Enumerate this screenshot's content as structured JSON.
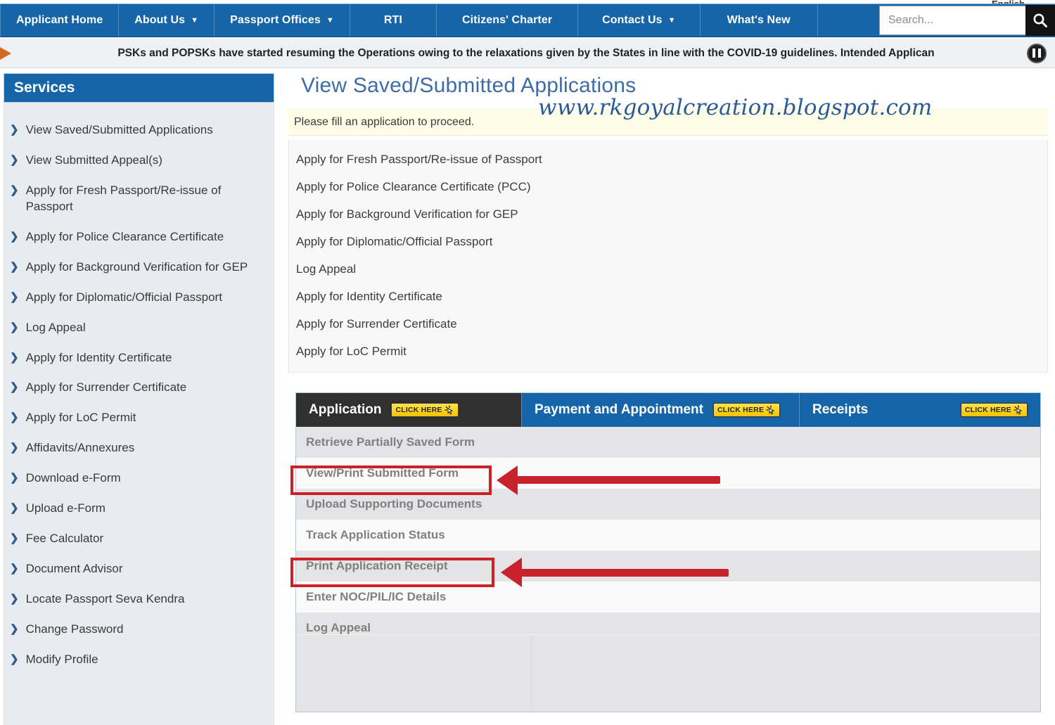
{
  "topbar": {
    "clipped_label": "English",
    "nav_items": [
      {
        "label": "Applicant Home",
        "caret": false
      },
      {
        "label": "About Us",
        "caret": true
      },
      {
        "label": "Passport Offices",
        "caret": true
      },
      {
        "label": "RTI",
        "caret": false
      },
      {
        "label": "Citizens' Charter",
        "caret": false
      },
      {
        "label": "Contact Us",
        "caret": true
      },
      {
        "label": "What's New",
        "caret": false
      }
    ],
    "search": {
      "placeholder": "Search...",
      "value": "",
      "button_icon": "search-icon"
    },
    "colors": {
      "nav_blue": "#1565a8",
      "search_button": "#131313"
    }
  },
  "marquee": {
    "arrow_icon": "play-triangle-icon",
    "text": "PSKs and POPSKs have started resuming the Operations owing to the relaxations given by the States in line with the COVID-19 guidelines. Intended Applican",
    "pause_icon": "pause-icon"
  },
  "sidebar": {
    "heading": "Services",
    "items": [
      "View Saved/Submitted Applications",
      "View Submitted Appeal(s)",
      "Apply for Fresh Passport/Re-issue of Passport",
      "Apply for Police Clearance Certificate",
      "Apply for Background Verification for GEP",
      "Apply for Diplomatic/Official Passport",
      "Log Appeal",
      "Apply for Identity Certificate",
      "Apply for Surrender Certificate",
      "Apply for LoC Permit",
      "Affidavits/Annexures",
      "Download e-Form",
      "Upload e-Form",
      "Fee Calculator",
      "Document Advisor",
      "Locate Passport Seva Kendra",
      "Change Password",
      "Modify Profile"
    ]
  },
  "main": {
    "page_title": "View Saved/Submitted Applications",
    "watermark": "www.rkgoyalcreation.blogspot.com",
    "alert_text": "Please fill an application to proceed.",
    "apply_items": [
      "Apply for Fresh Passport/Re-issue of Passport",
      "Apply for Police Clearance Certificate (PCC)",
      "Apply for Background Verification for GEP",
      "Apply for Diplomatic/Official Passport",
      "Log Appeal",
      "Apply for Identity Certificate",
      "Apply for Surrender Certificate",
      "Apply for LoC Permit"
    ]
  },
  "panel": {
    "tabs": [
      {
        "label": "Application",
        "badge": "CLICK HERE",
        "active": true
      },
      {
        "label": "Payment and Appointment",
        "badge": "CLICK HERE",
        "active": false
      },
      {
        "label": "Receipts",
        "badge": "CLICK HERE",
        "active": false
      }
    ],
    "rows": [
      {
        "label": "Retrieve Partially Saved Form",
        "highlighted": false
      },
      {
        "label": "View/Print Submitted Form",
        "highlighted": true
      },
      {
        "label": "Upload Supporting Documents",
        "highlighted": false
      },
      {
        "label": "Track Application Status",
        "highlighted": false
      },
      {
        "label": "Print Application Receipt",
        "highlighted": true
      },
      {
        "label": "Enter NOC/PIL/IC Details",
        "highlighted": false
      },
      {
        "label": "Log Appeal",
        "highlighted": false
      }
    ]
  },
  "annotation": {
    "highlight_color": "#cc2127",
    "arrow_color": "#c8232c",
    "callouts": [
      {
        "target": "View/Print Submitted Form"
      },
      {
        "target": "Print Application Receipt"
      }
    ]
  }
}
